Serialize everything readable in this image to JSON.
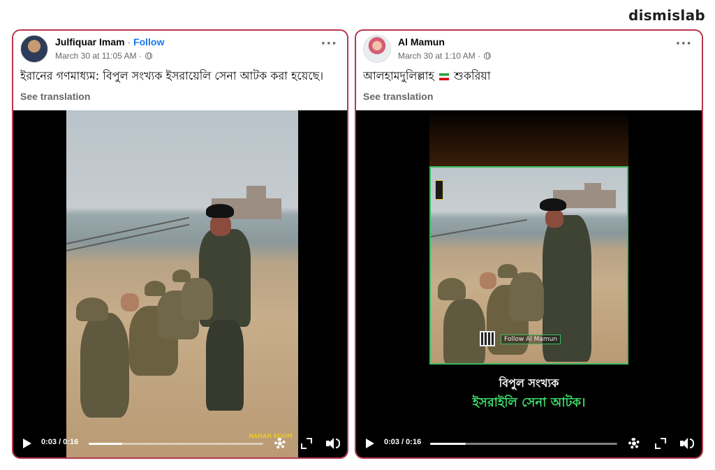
{
  "brand": {
    "name": "dismislab"
  },
  "posts": [
    {
      "author": "Julfiquar Imam",
      "follow_label": "Follow",
      "timestamp": "March 30 at 11:05 AM",
      "text": "ইরানের গণমাধ্যম: বিপুল সংখ্যক ইসরায়েলি সেনা আটক করা হয়েছে।",
      "see_translation": "See translation",
      "video": {
        "time": "0:03 / 0:16",
        "progress": 0.19,
        "watermark": "NANAN KOOM"
      }
    },
    {
      "author": "Al Mamun",
      "timestamp": "March 30 at 1:10 AM",
      "text_before_flag": "আলহামদুলিল্লাহ",
      "text_after_flag": "শুকরিয়া",
      "see_translation": "See translation",
      "video": {
        "time": "0:03 / 0:16",
        "progress": 0.19,
        "overlay_follow": "Follow Al Mamun",
        "caption_line1": "বিপুল সংখ্যক",
        "caption_line2": "ইসরাইলি সেনা আটক।"
      }
    }
  ],
  "colors": {
    "post_border": "#b9364f",
    "follow_link": "#1877f2",
    "caption_green": "#3ddc6a",
    "frame_green": "#3dbd63"
  },
  "icons": [
    "globe-icon",
    "more-icon",
    "play-icon",
    "gear-icon",
    "expand-icon",
    "volume-icon",
    "flag-icon",
    "qr-icon"
  ]
}
